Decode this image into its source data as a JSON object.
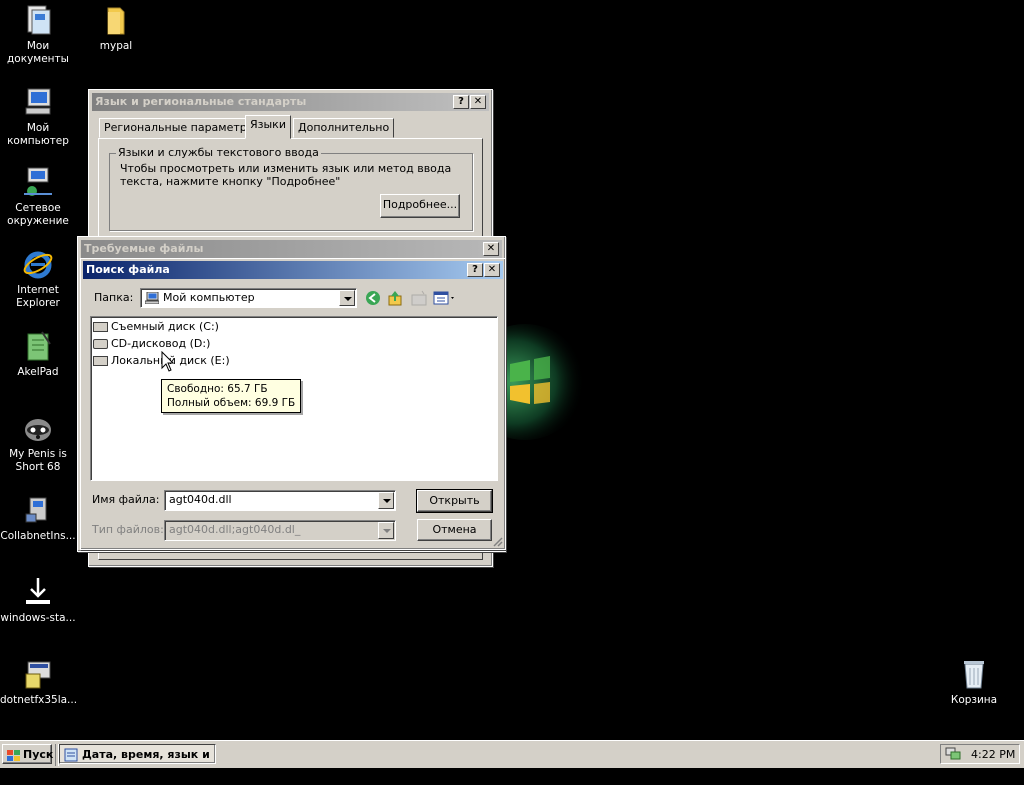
{
  "desktop": {
    "icons": [
      {
        "label": "Мои документы",
        "icon": "my-documents-icon"
      },
      {
        "label": "mypal",
        "icon": "folder-icon"
      },
      {
        "label": "Мой компьютер",
        "icon": "my-computer-icon"
      },
      {
        "label": "Сетевое окружение",
        "icon": "network-icon"
      },
      {
        "label": "Internet Explorer",
        "icon": "internet-explorer-icon"
      },
      {
        "label": "AkelPad",
        "icon": "akelpad-icon"
      },
      {
        "label": "My Penis is Short 68",
        "icon": "raccoon-icon"
      },
      {
        "label": "CollabnetIns...",
        "icon": "installer-icon"
      },
      {
        "label": "windows-sta...",
        "icon": "download-icon"
      },
      {
        "label": "dotnetfx35la...",
        "icon": "setup-icon"
      },
      {
        "label": "Корзина",
        "icon": "recycle-bin-icon"
      }
    ]
  },
  "regional_window": {
    "title": "Язык и региональные стандарты",
    "tabs": [
      "Региональные параметры",
      "Языки",
      "Дополнительно"
    ],
    "selected_tab": "Языки",
    "group_label": "Языки и службы текстового ввода",
    "description": "Чтобы просмотреть или изменить язык или метод ввода текста, нажмите кнопку \"Подробнее\"",
    "details_button": "Подробнее..."
  },
  "required_files_window": {
    "title": "Требуемые файлы"
  },
  "find_file_dialog": {
    "title": "Поиск файла",
    "folder_label": "Папка:",
    "folder_value": "Мой компьютер",
    "drives": [
      {
        "label": "Съемный диск (C:)"
      },
      {
        "label": "CD-дисковод (D:)"
      },
      {
        "label": "Локальный диск (E:)"
      }
    ],
    "tooltip": {
      "free": "Свободно: 65.7 ГБ",
      "total": "Полный объем: 69.9 ГБ"
    },
    "filename_label": "Имя файла:",
    "filename_value": "agt040d.dll",
    "filetype_label": "Тип файлов:",
    "filetype_value": "agt040d.dll;agt040d.dl_",
    "open_button": "Открыть",
    "cancel_button": "Отмена"
  },
  "taskbar": {
    "start_label": "Пуск",
    "task_label": "Дата, время, язык и ...",
    "clock": "4:22 PM"
  }
}
